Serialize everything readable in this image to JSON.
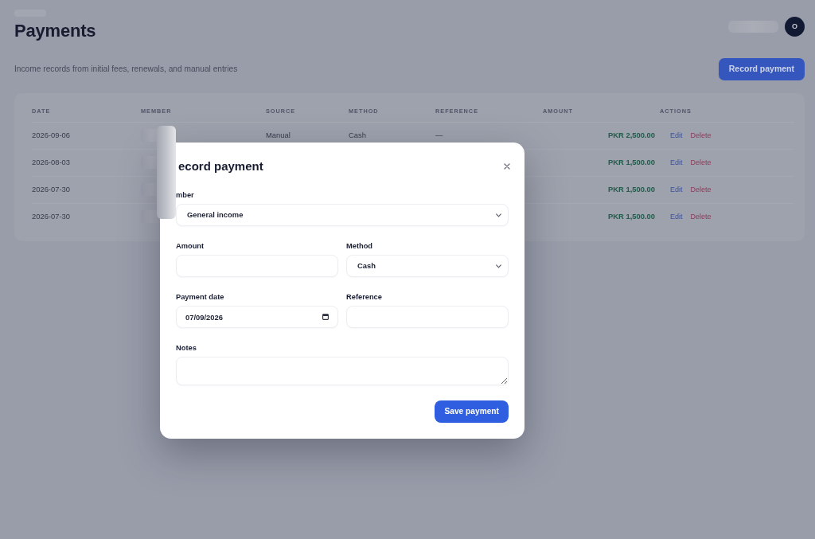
{
  "header": {
    "breadcrumb_blurred": true,
    "title": "Payments",
    "user_name_blurred": true,
    "avatar_initial": "O",
    "subtitle": "Income records from initial fees, renewals, and manual entries",
    "primary_button": "Record payment"
  },
  "table": {
    "columns": [
      "DATE",
      "MEMBER",
      "SOURCE",
      "METHOD",
      "REFERENCE",
      "AMOUNT",
      "ACTIONS"
    ],
    "rows": [
      {
        "date": "2026-09-06",
        "member_blurred": true,
        "source": "Manual",
        "method": "Cash",
        "reference": "—",
        "amount": "PKR 2,500.00",
        "actions": [
          {
            "kind": "edit",
            "label": "Edit"
          },
          {
            "kind": "delete",
            "label": "Delete"
          }
        ]
      },
      {
        "date": "2026-08-03",
        "member_blurred": true,
        "amount": "PKR 1,500.00",
        "actions": [
          {
            "kind": "edit",
            "label": "Edit"
          },
          {
            "kind": "delete",
            "label": "Delete"
          }
        ]
      },
      {
        "date": "2026-07-30",
        "member_blurred": true,
        "amount": "PKR 1,500.00",
        "actions": [
          {
            "kind": "edit",
            "label": "Edit"
          },
          {
            "kind": "delete",
            "label": "Delete"
          }
        ]
      },
      {
        "date": "2026-07-30",
        "member_blurred": true,
        "amount": "PKR 1,500.00",
        "actions": [
          {
            "kind": "edit",
            "label": "Edit"
          },
          {
            "kind": "delete",
            "label": "Delete"
          }
        ]
      }
    ]
  },
  "dialog": {
    "edge_blurred": true,
    "title": "ecord payment",
    "field_rows": [
      [
        {
          "kind": "select",
          "label": "mber",
          "value": "General income"
        }
      ],
      [
        {
          "kind": "text",
          "label": "Amount"
        },
        {
          "kind": "select",
          "label": "Method",
          "value": "Cash"
        }
      ],
      [
        {
          "kind": "date",
          "label": "Payment date",
          "value": "07/09/2026"
        },
        {
          "kind": "text",
          "label": "Reference"
        }
      ],
      [
        {
          "kind": "textarea",
          "label": "Notes"
        }
      ]
    ],
    "submit_button": "Save payment"
  }
}
